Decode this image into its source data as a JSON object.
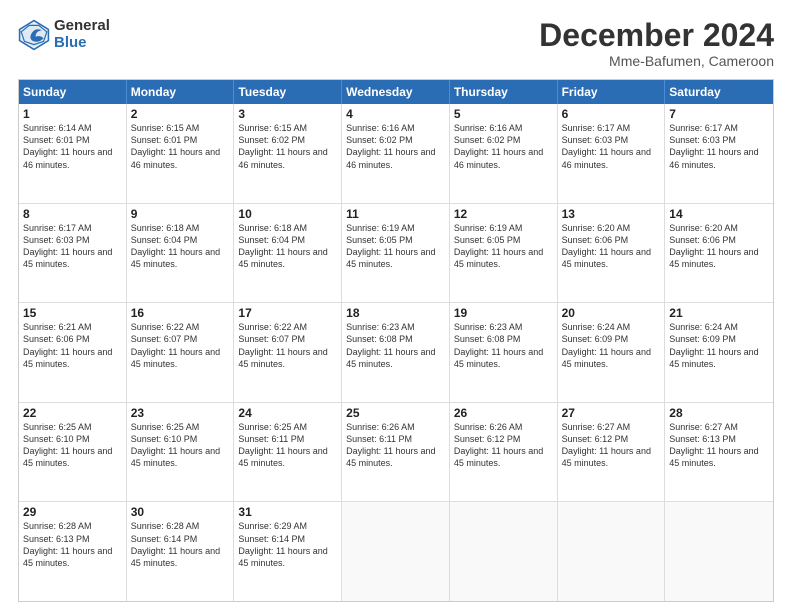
{
  "header": {
    "logo_general": "General",
    "logo_blue": "Blue",
    "title": "December 2024",
    "subtitle": "Mme-Bafumen, Cameroon"
  },
  "calendar": {
    "days": [
      "Sunday",
      "Monday",
      "Tuesday",
      "Wednesday",
      "Thursday",
      "Friday",
      "Saturday"
    ],
    "weeks": [
      [
        {
          "day": 1,
          "sunrise": "6:14 AM",
          "sunset": "6:01 PM",
          "daylight": "11 hours and 46 minutes."
        },
        {
          "day": 2,
          "sunrise": "6:15 AM",
          "sunset": "6:01 PM",
          "daylight": "11 hours and 46 minutes."
        },
        {
          "day": 3,
          "sunrise": "6:15 AM",
          "sunset": "6:02 PM",
          "daylight": "11 hours and 46 minutes."
        },
        {
          "day": 4,
          "sunrise": "6:16 AM",
          "sunset": "6:02 PM",
          "daylight": "11 hours and 46 minutes."
        },
        {
          "day": 5,
          "sunrise": "6:16 AM",
          "sunset": "6:02 PM",
          "daylight": "11 hours and 46 minutes."
        },
        {
          "day": 6,
          "sunrise": "6:17 AM",
          "sunset": "6:03 PM",
          "daylight": "11 hours and 46 minutes."
        },
        {
          "day": 7,
          "sunrise": "6:17 AM",
          "sunset": "6:03 PM",
          "daylight": "11 hours and 46 minutes."
        }
      ],
      [
        {
          "day": 8,
          "sunrise": "6:17 AM",
          "sunset": "6:03 PM",
          "daylight": "11 hours and 45 minutes."
        },
        {
          "day": 9,
          "sunrise": "6:18 AM",
          "sunset": "6:04 PM",
          "daylight": "11 hours and 45 minutes."
        },
        {
          "day": 10,
          "sunrise": "6:18 AM",
          "sunset": "6:04 PM",
          "daylight": "11 hours and 45 minutes."
        },
        {
          "day": 11,
          "sunrise": "6:19 AM",
          "sunset": "6:05 PM",
          "daylight": "11 hours and 45 minutes."
        },
        {
          "day": 12,
          "sunrise": "6:19 AM",
          "sunset": "6:05 PM",
          "daylight": "11 hours and 45 minutes."
        },
        {
          "day": 13,
          "sunrise": "6:20 AM",
          "sunset": "6:06 PM",
          "daylight": "11 hours and 45 minutes."
        },
        {
          "day": 14,
          "sunrise": "6:20 AM",
          "sunset": "6:06 PM",
          "daylight": "11 hours and 45 minutes."
        }
      ],
      [
        {
          "day": 15,
          "sunrise": "6:21 AM",
          "sunset": "6:06 PM",
          "daylight": "11 hours and 45 minutes."
        },
        {
          "day": 16,
          "sunrise": "6:22 AM",
          "sunset": "6:07 PM",
          "daylight": "11 hours and 45 minutes."
        },
        {
          "day": 17,
          "sunrise": "6:22 AM",
          "sunset": "6:07 PM",
          "daylight": "11 hours and 45 minutes."
        },
        {
          "day": 18,
          "sunrise": "6:23 AM",
          "sunset": "6:08 PM",
          "daylight": "11 hours and 45 minutes."
        },
        {
          "day": 19,
          "sunrise": "6:23 AM",
          "sunset": "6:08 PM",
          "daylight": "11 hours and 45 minutes."
        },
        {
          "day": 20,
          "sunrise": "6:24 AM",
          "sunset": "6:09 PM",
          "daylight": "11 hours and 45 minutes."
        },
        {
          "day": 21,
          "sunrise": "6:24 AM",
          "sunset": "6:09 PM",
          "daylight": "11 hours and 45 minutes."
        }
      ],
      [
        {
          "day": 22,
          "sunrise": "6:25 AM",
          "sunset": "6:10 PM",
          "daylight": "11 hours and 45 minutes."
        },
        {
          "day": 23,
          "sunrise": "6:25 AM",
          "sunset": "6:10 PM",
          "daylight": "11 hours and 45 minutes."
        },
        {
          "day": 24,
          "sunrise": "6:25 AM",
          "sunset": "6:11 PM",
          "daylight": "11 hours and 45 minutes."
        },
        {
          "day": 25,
          "sunrise": "6:26 AM",
          "sunset": "6:11 PM",
          "daylight": "11 hours and 45 minutes."
        },
        {
          "day": 26,
          "sunrise": "6:26 AM",
          "sunset": "6:12 PM",
          "daylight": "11 hours and 45 minutes."
        },
        {
          "day": 27,
          "sunrise": "6:27 AM",
          "sunset": "6:12 PM",
          "daylight": "11 hours and 45 minutes."
        },
        {
          "day": 28,
          "sunrise": "6:27 AM",
          "sunset": "6:13 PM",
          "daylight": "11 hours and 45 minutes."
        }
      ],
      [
        {
          "day": 29,
          "sunrise": "6:28 AM",
          "sunset": "6:13 PM",
          "daylight": "11 hours and 45 minutes."
        },
        {
          "day": 30,
          "sunrise": "6:28 AM",
          "sunset": "6:14 PM",
          "daylight": "11 hours and 45 minutes."
        },
        {
          "day": 31,
          "sunrise": "6:29 AM",
          "sunset": "6:14 PM",
          "daylight": "11 hours and 45 minutes."
        },
        null,
        null,
        null,
        null
      ]
    ]
  }
}
